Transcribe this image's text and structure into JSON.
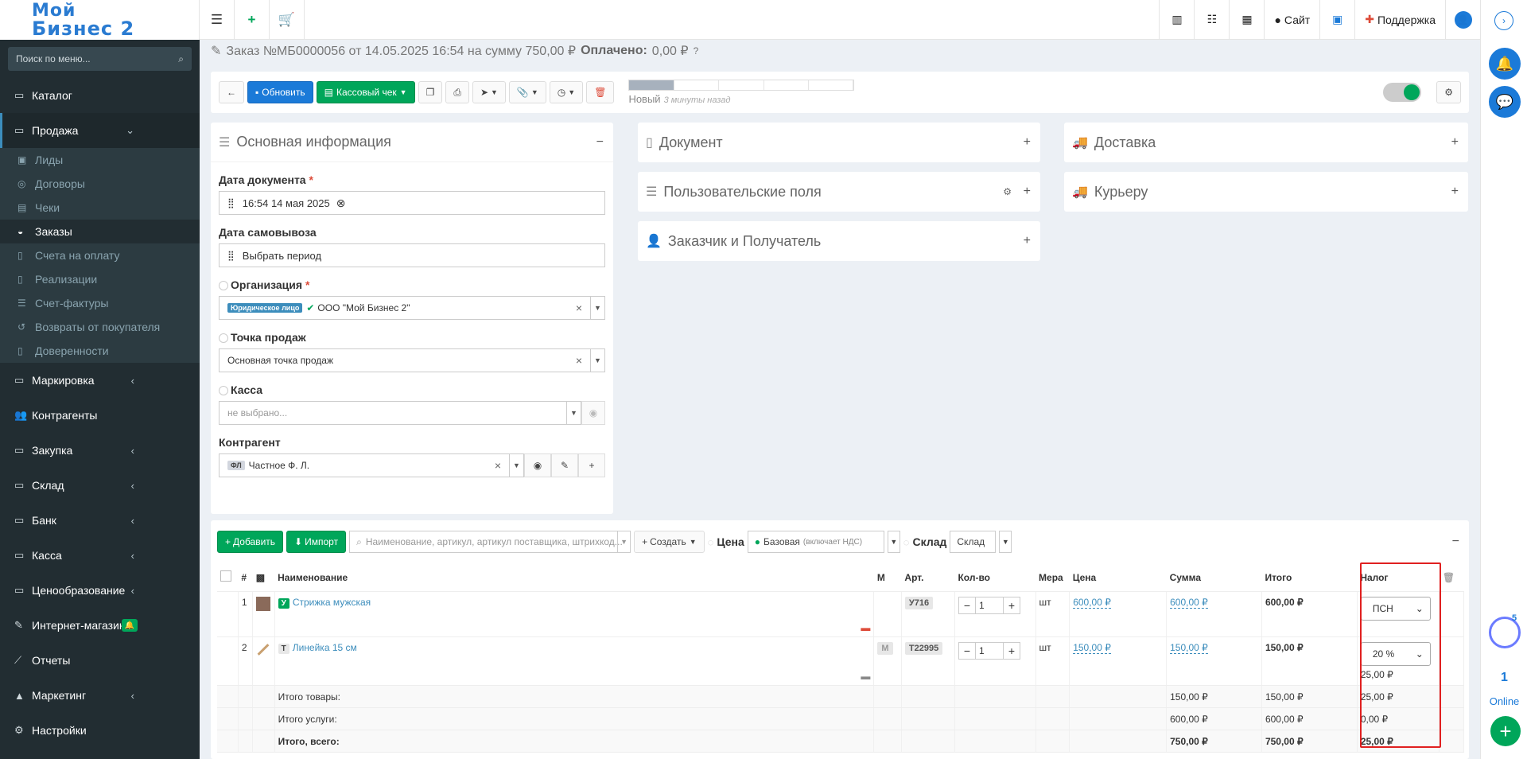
{
  "logo": {
    "line1": "Мой",
    "line2": "Бизнес 2"
  },
  "topbar": {
    "site_label": "Сайт",
    "support_label": "Поддержка"
  },
  "sidebar": {
    "search_placeholder": "Поиск по меню...",
    "items": [
      {
        "label": "Каталог",
        "icon": "folder-icon"
      },
      {
        "label": "Продажа",
        "icon": "folder-icon"
      },
      {
        "label": "Маркировка",
        "icon": "folder-icon"
      },
      {
        "label": "Контрагенты",
        "icon": "users-icon"
      },
      {
        "label": "Закупка",
        "icon": "folder-icon"
      },
      {
        "label": "Склад",
        "icon": "folder-icon"
      },
      {
        "label": "Банк",
        "icon": "folder-icon"
      },
      {
        "label": "Касса",
        "icon": "folder-icon"
      },
      {
        "label": "Ценообразование",
        "icon": "folder-icon"
      },
      {
        "label": "Интернет-магазин",
        "icon": "magic-icon"
      },
      {
        "label": "Отчеты",
        "icon": "chart-icon"
      },
      {
        "label": "Маркетинг",
        "icon": "bullhorn-icon"
      },
      {
        "label": "Настройки",
        "icon": "gear-icon"
      }
    ],
    "sub_items": [
      "Лиды",
      "Договоры",
      "Чеки",
      "Заказы",
      "Счета на оплату",
      "Реализации",
      "Счет-фактуры",
      "Возвраты от покупателя",
      "Доверенности"
    ]
  },
  "page": {
    "title": "Заказ №МБ0000056 от 14.05.2025 16:54 на сумму 750,00 ₽",
    "paid_label": "Оплачено:",
    "paid_value": "0,00 ₽"
  },
  "toolbar": {
    "update_label": "Обновить",
    "receipt_label": "Кассовый чек",
    "status_label": "Новый",
    "status_time": "3 минуты назад"
  },
  "main_info": {
    "title": "Основная информация",
    "doc_date_label": "Дата документа",
    "doc_date_value": "16:54 14 мая 2025",
    "pickup_label": "Дата самовывоза",
    "pickup_value": "Выбрать период",
    "org_label": "Организация",
    "org_tag": "Юридическое лицо",
    "org_value": "ООО \"Мой Бизнес 2\"",
    "point_label": "Точка продаж",
    "point_value": "Основная точка продаж",
    "cash_label": "Касса",
    "cash_value": "не выбрано...",
    "contractor_label": "Контрагент",
    "contractor_tag": "ФЛ",
    "contractor_value": "Частное Ф. Л."
  },
  "panels": {
    "document": "Документ",
    "custom_fields": "Пользовательские поля",
    "customer": "Заказчик и Получатель",
    "delivery": "Доставка",
    "courier": "Курьеру"
  },
  "items": {
    "add_label": "Добавить",
    "import_label": "Импорт",
    "search_placeholder": "Наименование, артикул, артикул поставщика, штрихкод...",
    "create_label": "Создать",
    "price_label": "Цена",
    "price_value": "Базовая",
    "price_note": "(включает НДС)",
    "warehouse_label": "Склад",
    "warehouse_value": "Склад",
    "headers": [
      "#",
      "Наименование",
      "М",
      "Арт.",
      "Кол-во",
      "Мера",
      "Цена",
      "Сумма",
      "Итого",
      "Налог"
    ],
    "rows": [
      {
        "n": "1",
        "type": "У",
        "name": "Стрижка мужская",
        "m": "",
        "art": "У716",
        "qty": "1",
        "unit": "шт",
        "price": "600,00 ₽",
        "sum": "600,00 ₽",
        "total": "600,00 ₽",
        "tax": "ПСН",
        "tax_amount": ""
      },
      {
        "n": "2",
        "type": "Т",
        "name": "Линейка 15 см",
        "m": "М",
        "art": "Т22995",
        "qty": "1",
        "unit": "шт",
        "price": "150,00 ₽",
        "sum": "150,00 ₽",
        "total": "150,00 ₽",
        "tax": "20 %",
        "tax_amount": "25,00 ₽"
      }
    ],
    "totals": [
      {
        "label": "Итого товары:",
        "sum": "150,00 ₽",
        "total": "150,00 ₽",
        "tax": "25,00 ₽"
      },
      {
        "label": "Итого услуги:",
        "sum": "600,00 ₽",
        "total": "600,00 ₽",
        "tax": "0,00 ₽"
      },
      {
        "label": "Итого, всего:",
        "sum": "750,00 ₽",
        "total": "750,00 ₽",
        "tax": "25,00 ₽"
      }
    ]
  },
  "rail": {
    "badge": "5",
    "online_count": "1",
    "online_label": "Online"
  }
}
